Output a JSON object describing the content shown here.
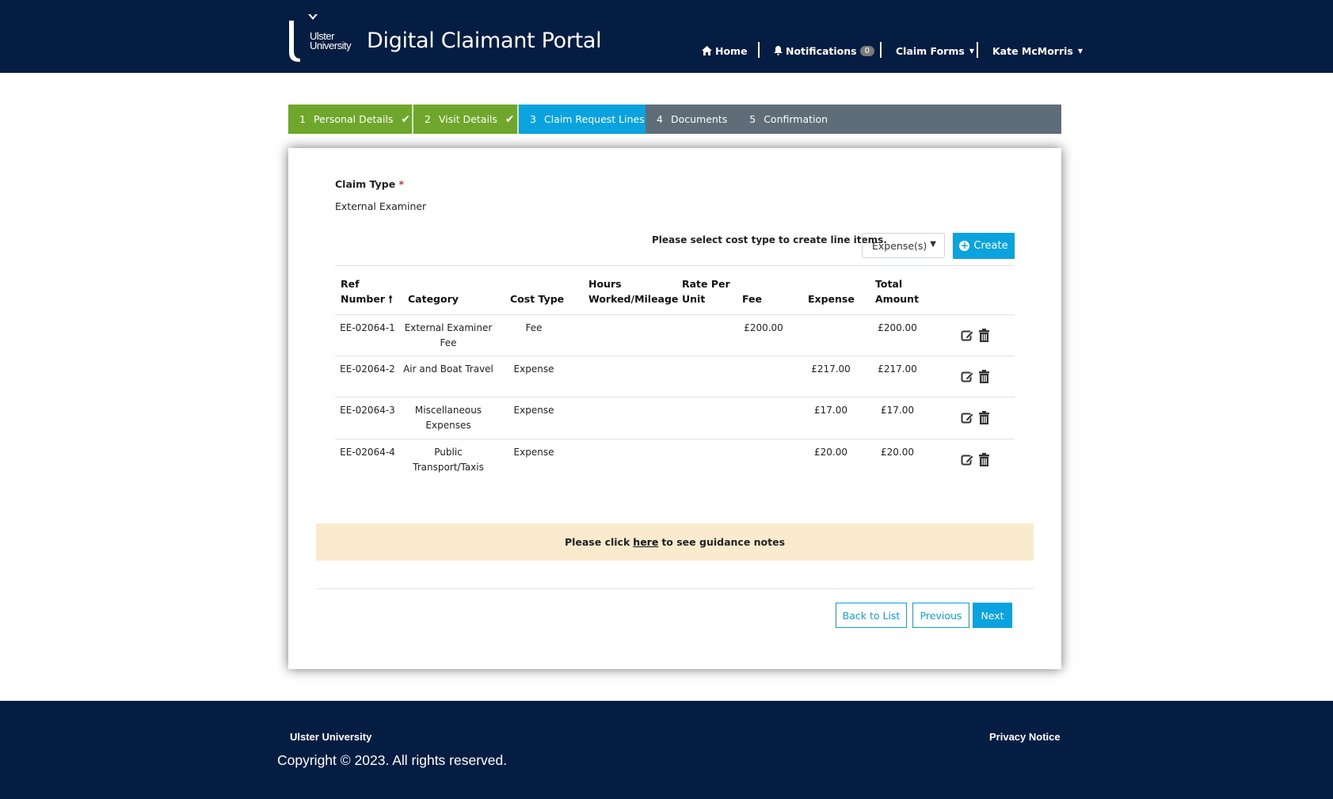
{
  "header": {
    "logo_line1": "Ulster",
    "logo_line2": "University",
    "title": "Digital Claimant Portal",
    "nav": {
      "home": "Home",
      "notifications": "Notifications",
      "notifications_count": "0",
      "claim_forms": "Claim Forms",
      "user": "Kate McMorris"
    }
  },
  "wizard": {
    "steps": [
      {
        "num": "1",
        "label": "Personal Details",
        "state": "done"
      },
      {
        "num": "2",
        "label": "Visit Details",
        "state": "done"
      },
      {
        "num": "3",
        "label": "Claim Request Lines",
        "state": "active"
      },
      {
        "num": "4",
        "label": "Documents",
        "state": "pending"
      },
      {
        "num": "5",
        "label": "Confirmation",
        "state": "pending"
      }
    ],
    "colors": {
      "done": "#6fa72c",
      "active": "#0aa3df",
      "pending": "#5f6d79"
    }
  },
  "form": {
    "claim_type_label": "Claim Type",
    "required_mark": "*",
    "claim_type_value": "External Examiner",
    "cost_prompt": "Please select cost type to create line items.",
    "cost_select_value": "Expense(s)",
    "create_label": "Create"
  },
  "table": {
    "headers": {
      "ref_line1": "Ref",
      "ref_line2": "Number",
      "category": "Category",
      "cost_type": "Cost Type",
      "hours_line1": "Hours",
      "hours_line2": "Worked/Mileage",
      "rate_line1": "Rate Per",
      "rate_line2": "Unit",
      "fee": "Fee",
      "expense": "Expense",
      "total_line1": "Total",
      "total_line2": "Amount"
    },
    "rows": [
      {
        "ref": "EE-02064-1",
        "category_line1": "External Examiner",
        "category_line2": "Fee",
        "cost_type": "Fee",
        "hours": "",
        "rate": "",
        "fee": "£200.00",
        "expense": "",
        "total": "£200.00"
      },
      {
        "ref": "EE-02064-2",
        "category_line1": "Air and Boat Travel",
        "category_line2": "",
        "cost_type": "Expense",
        "hours": "",
        "rate": "",
        "fee": "",
        "expense": "£217.00",
        "total": "£217.00"
      },
      {
        "ref": "EE-02064-3",
        "category_line1": "Miscellaneous",
        "category_line2": "Expenses",
        "cost_type": "Expense",
        "hours": "",
        "rate": "",
        "fee": "",
        "expense": "£17.00",
        "total": "£17.00"
      },
      {
        "ref": "EE-02064-4",
        "category_line1": "Public",
        "category_line2": "Transport/Taxis",
        "cost_type": "Expense",
        "hours": "",
        "rate": "",
        "fee": "",
        "expense": "£20.00",
        "total": "£20.00"
      }
    ]
  },
  "guidance": {
    "prefix": "Please click",
    "link": "here",
    "suffix": "to see guidance notes"
  },
  "actions": {
    "back": "Back to List",
    "previous": "Previous",
    "next": "Next"
  },
  "footer": {
    "org": "Ulster University",
    "copyright": "Copyright © 2023. All rights reserved.",
    "privacy": "Privacy Notice"
  }
}
